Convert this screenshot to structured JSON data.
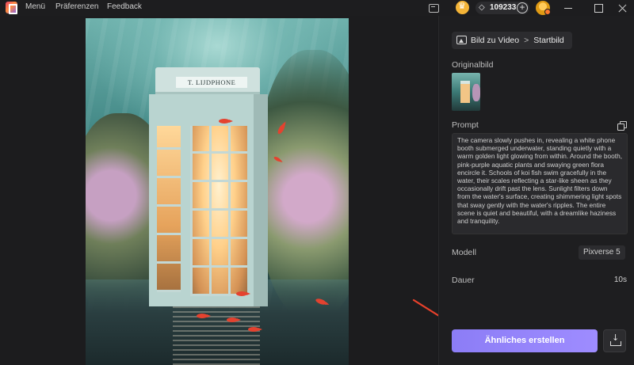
{
  "menu": {
    "items": [
      "Menü",
      "Präferenzen",
      "Feedback"
    ]
  },
  "topbar": {
    "credits": "109233",
    "credits_add": "+"
  },
  "preview": {
    "sign_text": "T. LIJDPHONE"
  },
  "panel": {
    "breadcrumb": {
      "mode": "Bild zu Video",
      "separator": ">",
      "current": "Startbild"
    },
    "original_label": "Originalbild",
    "prompt_label": "Prompt",
    "prompt_text": "The camera slowly pushes in, revealing a white phone booth submerged underwater, standing quietly with a warm golden light glowing from within. Around the booth, pink-purple aquatic plants and swaying green flora encircle it. Schools of koi fish swim gracefully in the water, their scales reflecting a star-like sheen as they occasionally drift past the lens. Sunlight filters down from the water's surface, creating shimmering light spots that sway gently with the water's ripples. The entire scene is quiet and beautiful, with a dreamlike haziness and tranquility.",
    "model_label": "Modell",
    "model_value": "Pixverse 5",
    "duration_label": "Dauer",
    "duration_value": "10s",
    "create_button": "Ähnliches erstellen"
  },
  "colors": {
    "accent": "#9b8aff",
    "annotation_arrow": "#e8412b"
  },
  "icons": [
    "app-logo-icon",
    "monitor-icon",
    "crown-icon",
    "diamond-icon",
    "plus-icon",
    "avatar",
    "minimize-icon",
    "maximize-icon",
    "close-icon",
    "image-to-video-icon",
    "copy-icon",
    "download-icon"
  ]
}
